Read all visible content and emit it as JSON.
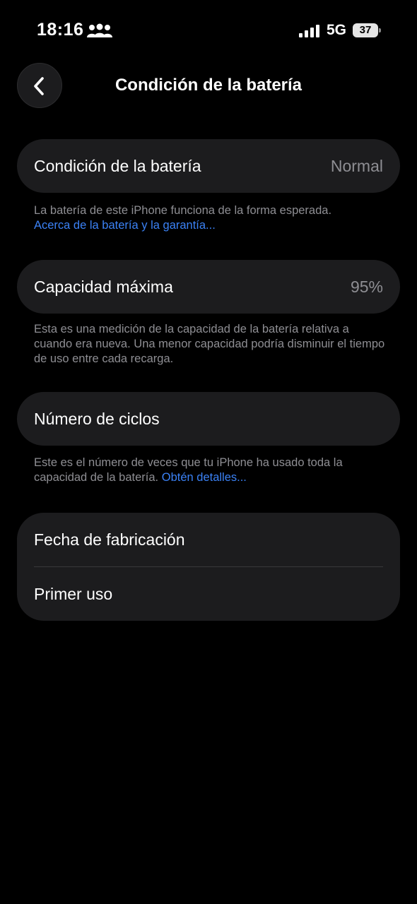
{
  "status_bar": {
    "time": "18:16",
    "network": "5G",
    "battery_level": "37",
    "icons": [
      "people-icon",
      "signal-icon",
      "battery-icon"
    ]
  },
  "header": {
    "title": "Condición de la batería",
    "back_icon": "chevron-left-icon"
  },
  "sections": {
    "health": {
      "label": "Condición de la batería",
      "value": "Normal",
      "note": "La batería de este iPhone funciona de la forma esperada.",
      "link": "Acerca de la batería y la garantía..."
    },
    "capacity": {
      "label": "Capacidad máxima",
      "value": "95%",
      "note": "Esta es una medición de la capacidad de la batería relativa a cuando era nueva. Una menor capacidad podría disminuir el tiempo de uso entre cada recarga."
    },
    "cycles": {
      "label": "Número de ciclos",
      "note": "Este es el número de veces que tu iPhone ha usado toda la capacidad de la batería.",
      "link": "Obtén detalles..."
    },
    "dates": {
      "manufacture_label": "Fecha de fabricación",
      "first_use_label": "Primer uso"
    }
  },
  "colors": {
    "background": "#000000",
    "card": "#1c1c1e",
    "secondary_text": "#8e8e93",
    "link": "#3b82f6"
  }
}
